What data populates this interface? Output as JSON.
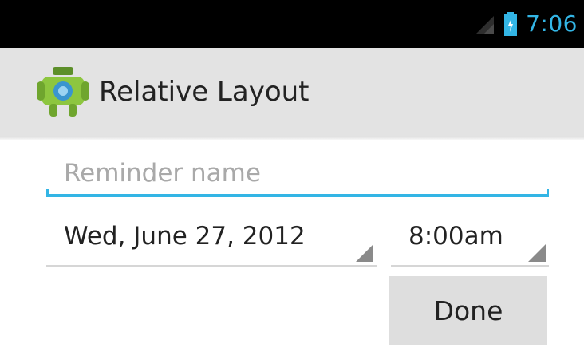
{
  "status_bar": {
    "time": "7:06",
    "icons": [
      "signal-icon",
      "battery-icon"
    ],
    "clock_color": "#33b5e5"
  },
  "action_bar": {
    "title": "Relative Layout",
    "icon": "android-app-icon",
    "background": "#e3e3e3"
  },
  "form": {
    "reminder_placeholder": "Reminder name",
    "reminder_value": "",
    "date_value": "Wed, June 27, 2012",
    "time_value": "8:00am",
    "done_label": "Done"
  },
  "colors": {
    "accent": "#33b5e5",
    "status_bar": "#000000",
    "button": "#dedede"
  }
}
